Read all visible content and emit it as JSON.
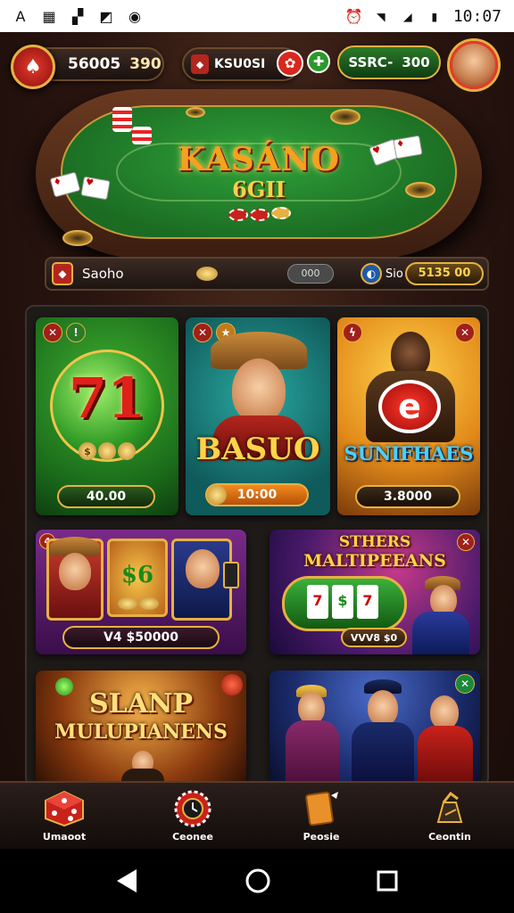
{
  "status_bar": {
    "time": "10:07",
    "left_icons": [
      "alert-icon",
      "news-icon",
      "bookmark-icon",
      "image-icon",
      "whatsapp-icon"
    ],
    "right_icons": [
      "alarm-icon",
      "wifi-icon",
      "signal-icon",
      "battery-icon"
    ]
  },
  "hud": {
    "balance_label": "56005",
    "balance_value": "390",
    "center_label": "KSU0SI",
    "coins_label": "SSRC-",
    "coins_value": "300"
  },
  "table": {
    "title": "KASÁNO",
    "subtitle": "6GII",
    "bar_label": "Saoho",
    "bar_mid": "000",
    "bar_tag": "Sio",
    "bar_value": "5135 00"
  },
  "tiles": [
    {
      "title": "71",
      "price": "40.00",
      "coin_text": "$"
    },
    {
      "title": "BASUO",
      "price": "10:00"
    },
    {
      "title": "SUNIFHAES",
      "price": "3.8000"
    },
    {
      "price": "V4 $50000"
    },
    {
      "title_line1": "STHERS",
      "title_line2": "MALTIPEEANS",
      "price": "VVV8 $0"
    },
    {
      "title_line1": "SLANP",
      "title_line2": "MULUPIANENS"
    },
    {}
  ],
  "bottom_nav": [
    {
      "label": "Umaoot",
      "icon": "dice-icon"
    },
    {
      "label": "Ceonee",
      "icon": "roulette-icon"
    },
    {
      "label": "Peosie",
      "icon": "card-icon"
    },
    {
      "label": "Ceontin",
      "icon": "trophy-icon"
    }
  ],
  "colors": {
    "accent": "#e7b142",
    "felt": "#1b6b22",
    "brand_red": "#c8221a"
  }
}
